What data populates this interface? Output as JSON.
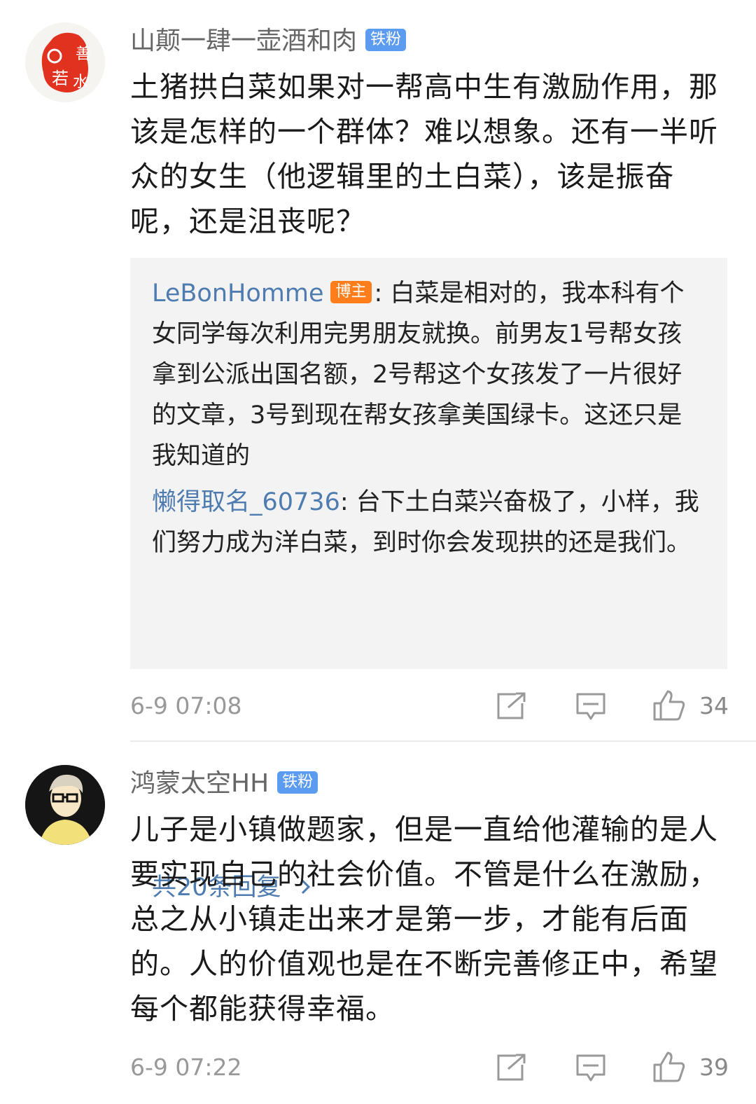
{
  "comments": [
    {
      "username": "山颠一肆一壶酒和肉",
      "badge": "铁粉",
      "avatar_icon": "red-seal-avatar",
      "content": "土猪拱白菜如果对一帮高中生有激励作用，那该是怎样的一个群体？难以想象。还有一半听众的女生（他逻辑里的土白菜），该是振奋呢，还是沮丧呢？",
      "replies": [
        {
          "username": "LeBonHomme",
          "badge": "博主",
          "separator": ":",
          "text": "白菜是相对的，我本科有个女同学每次利用完男朋友就换。前男友1号帮女孩拿到公派出国名额，2号帮这个女孩发了一片很好的文章，3号到现在帮女孩拿美国绿卡。这还只是我知道的"
        },
        {
          "username": "懒得取名_60736",
          "separator": ":",
          "text": "台下土白菜兴奋极了，小样，我们努力成为洋白菜，到时你会发现拱的还是我们。"
        }
      ],
      "more_replies": "共20条回复",
      "time": "6-9 07:08",
      "likes": "34"
    },
    {
      "username": "鸿蒙太空HH",
      "badge": "铁粉",
      "avatar_icon": "cartoon-man-glasses-avatar",
      "content": "儿子是小镇做题家，但是一直给他灌输的是人要实现自己的社会价值。不管是什么在激励，总之从小镇走出来才是第一步，才能有后面的。人的价值观也是在不断完善修正中，希望每个都能获得幸福。",
      "time": "6-9 07:22",
      "likes": "39"
    }
  ],
  "colors": {
    "badge_fan": "#5b9bf0",
    "badge_host": "#ff7d1a",
    "link": "#4e7cb1",
    "reply_bg": "#f3f3f3"
  }
}
